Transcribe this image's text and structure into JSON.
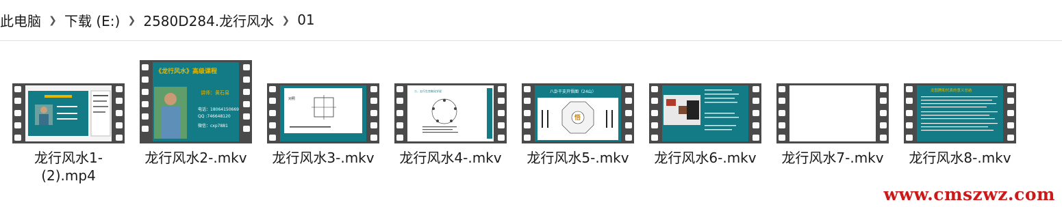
{
  "breadcrumb": {
    "items": [
      "此电脑",
      "下载 (E:)",
      "2580D284.龙行风水",
      "01"
    ]
  },
  "files": [
    {
      "name": "龙行风水1-(2).mp4",
      "line1": "龙行风水1-",
      "line2": "(2).mp4"
    },
    {
      "name": "龙行风水2-.mkv",
      "title": "《龙行风水》高级课程",
      "lecturer": "讲师：黄石易",
      "phone": "电话：18064150669",
      "qq": "QQ   :746648120",
      "wechat": "微信：cxp7881"
    },
    {
      "name": "龙行风水3-.mkv",
      "caption": "对照"
    },
    {
      "name": "龙行风水4-.mkv",
      "caption": "二、五行生克制化学说"
    },
    {
      "name": "龙行风水5-.mkv",
      "title": "八卦干支开悟图（24山）",
      "center": "悟"
    },
    {
      "name": "龙行风水6-.mkv"
    },
    {
      "name": "龙行风水7-.mkv"
    },
    {
      "name": "龙行风水8-.mkv",
      "title": "龙图腾和代表的意义总结"
    }
  ],
  "watermark": "www.cmszwz.com",
  "colors": {
    "slide_teal": "#127b86",
    "film_strip": "#4a4a4a",
    "watermark": "#cc1a1a"
  }
}
